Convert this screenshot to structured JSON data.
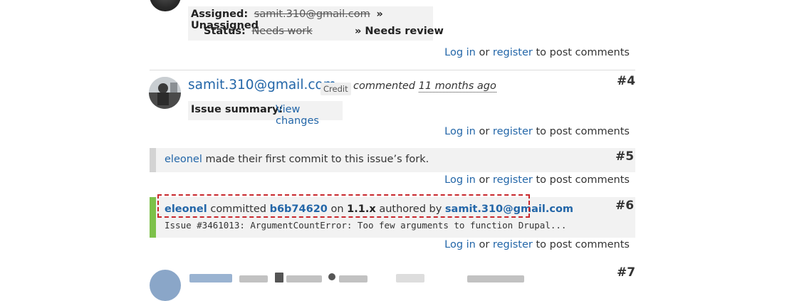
{
  "comment3": {
    "assigned_label": "Assigned:",
    "assigned_old": "samit.310@gmail.com",
    "assigned_new": "» Unassigned",
    "status_label": "Status:",
    "status_old": "Needs work",
    "status_new": "» Needs review",
    "login": "Log in",
    "or": "or",
    "register": "register",
    "post_suffix": "to post comments"
  },
  "comment4": {
    "author": "samit.310@gmail.com",
    "credit": "Credit",
    "commented": "commented",
    "time_ago": "11 months ago",
    "number": "#4",
    "summary_label": "Issue summary:",
    "summary_link": "View changes",
    "login": "Log in",
    "or": "or",
    "register": "register",
    "post_suffix": "to post comments"
  },
  "comment5": {
    "user": "eleonel",
    "text": "made their first commit to this issue’s fork.",
    "number": "#5",
    "login": "Log in",
    "or": "or",
    "register": "register",
    "post_suffix": "to post comments"
  },
  "comment6": {
    "user": "eleonel",
    "committed": "committed",
    "hash": "b6b74620",
    "on": "on",
    "branch": "1.1.x",
    "authored_by": "authored by",
    "author": "samit.310@gmail.com",
    "message": "Issue #3461013: ArgumentCountError: Too few arguments to function Drupal...",
    "number": "#6",
    "login": "Log in",
    "or": "or",
    "register": "register",
    "post_suffix": "to post comments"
  },
  "comment7": {
    "number": "#7"
  },
  "colors": {
    "link": "#2366a8",
    "commit_bar": "#7dc14a",
    "system_bar": "#d3d3d3",
    "highlight_dash": "#c8282d"
  }
}
